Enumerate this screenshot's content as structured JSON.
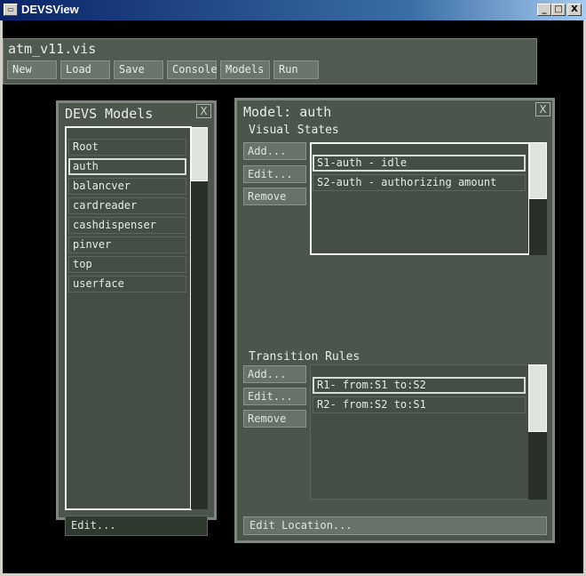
{
  "window": {
    "title": "DEVSView",
    "icon": "app-icon",
    "minimize": "_",
    "maximize": "□",
    "close": "X"
  },
  "toolbar": {
    "file_name": "atm_v11.vis",
    "buttons": [
      "New",
      "Load",
      "Save",
      "Console",
      "Models",
      "Run"
    ]
  },
  "models_panel": {
    "title": "DEVS Models",
    "close": "X",
    "items": [
      "Root",
      "auth",
      "balancver",
      "cardreader",
      "cashdispenser",
      "pinver",
      "top",
      "userface"
    ],
    "selected_index": 1,
    "edit_label": "Edit..."
  },
  "model_panel": {
    "title": "Model: auth",
    "close": "X",
    "visual_states": {
      "label": "Visual States",
      "add": "Add...",
      "edit": "Edit...",
      "remove": "Remove",
      "items": [
        "S1-auth - idle",
        "S2-auth - authorizing amount"
      ],
      "selected_index": 0
    },
    "transition_rules": {
      "label": "Transition Rules",
      "add": "Add...",
      "edit": "Edit...",
      "remove": "Remove",
      "items": [
        "R1- from:S1 to:S2",
        "R2- from:S2 to:S1"
      ],
      "selected_index": 0
    },
    "edit_location": "Edit Location..."
  }
}
